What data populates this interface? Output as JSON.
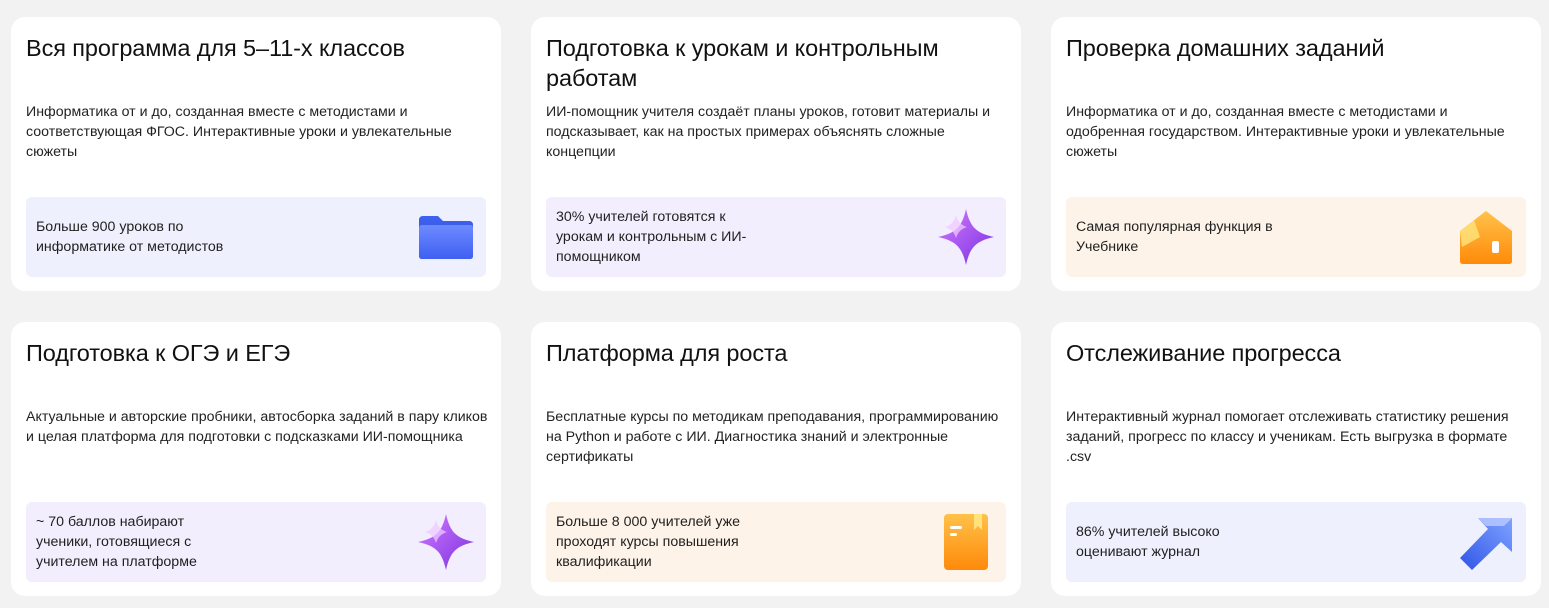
{
  "cards": [
    {
      "title": "Вся программа для 5–11-х классов",
      "description": "Информатика от и до, созданная вместе с методистами и соответствующая ФГОС. Интерактивные уроки и увлекательные сюжеты",
      "stat": "Больше 900 уроков по информатике от методистов",
      "icon": "folder-icon",
      "stat_bg": "#eef0fd"
    },
    {
      "title": "Подготовка к урокам и контрольным работам",
      "description": "ИИ-помощник учителя создаёт планы уроков, готовит материалы и подсказывает, как на простых примерах объяснять сложные концепции",
      "stat": "30% учителей готовятся к урокам и контрольным с ИИ-помощником",
      "icon": "sparkle-icon",
      "stat_bg": "#f3eefd"
    },
    {
      "title": "Проверка домашних заданий",
      "description": "Информатика от и до, созданная вместе с методистами и одобренная государством. Интерактивные уроки и увлекательные сюжеты",
      "stat": "Самая популярная функция в Учебнике",
      "icon": "house-icon",
      "stat_bg": "#fdf3e9"
    },
    {
      "title": "Подготовка к ОГЭ и ЕГЭ",
      "description": "Актуальные и авторские пробники, автосборка заданий в пару кликов и целая платформа для подготовки с подсказками ИИ-помощника",
      "stat": "~ 70 баллов набирают ученики, готовящиеся с учителем на платформе",
      "icon": "sparkle-icon",
      "stat_bg": "#f3eefd"
    },
    {
      "title": "Платформа для роста",
      "description": "Бесплатные курсы по методикам преподавания, программированию на Python и работе с ИИ. Диагностика знаний и электронные сертификаты",
      "stat": "Больше 8 000 учителей уже проходят курсы повышения квалификации",
      "icon": "notebook-icon",
      "stat_bg": "#fdf3e9"
    },
    {
      "title": "Отслеживание прогресса",
      "description": "Интерактивный журнал помогает отслеживать статистику решения заданий, прогресс по классу и ученикам. Есть выгрузка в формате .csv",
      "stat": "86% учителей высоко оценивают журнал",
      "icon": "arrow-up-right-icon",
      "stat_bg": "#eef0fd"
    }
  ]
}
